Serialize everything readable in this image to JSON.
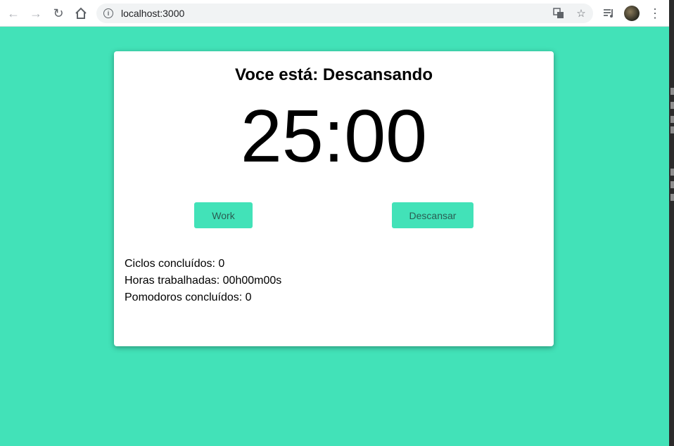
{
  "browser": {
    "url": "localhost:3000",
    "back_icon": "arrow-left-icon",
    "forward_icon": "arrow-right-icon",
    "reload_icon": "reload-icon",
    "home_icon": "home-icon",
    "info_icon": "info-icon",
    "translate_icon": "translate-icon",
    "bookmark_icon": "star-icon",
    "media_icon": "media-queue-icon",
    "menu_icon": "kebab-menu-icon"
  },
  "app": {
    "background_color": "#42e2b8",
    "accent_color": "#42e2b8",
    "status_text": "Voce está: Descansando",
    "timer": "25:00",
    "buttons": {
      "work": "Work",
      "rest": "Descansar"
    },
    "stats": {
      "cycles_label": "Ciclos concluídos: ",
      "cycles_value": "0",
      "hours_label": "Horas trabalhadas: ",
      "hours_value": "00h00m00s",
      "pomodoros_label": "Pomodoros concluídos: ",
      "pomodoros_value": "0"
    }
  }
}
